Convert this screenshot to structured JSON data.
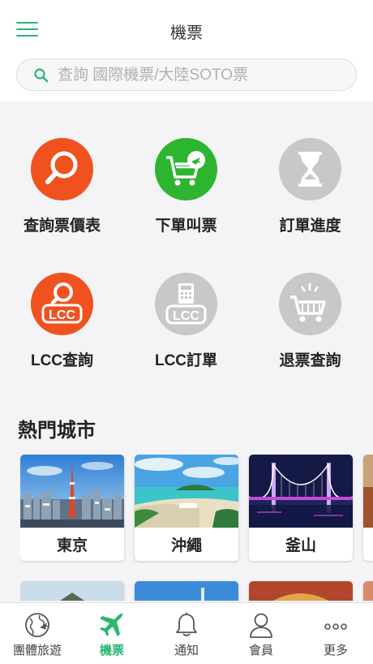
{
  "header": {
    "title": "機票",
    "search_placeholder": "查詢 國際機票/大陸SOTO票"
  },
  "menu": [
    {
      "label": "查詢票價表",
      "icon": "search-icon",
      "color": "#f0521f"
    },
    {
      "label": "下單叫票",
      "icon": "cart-plane-icon",
      "color": "#2db52f"
    },
    {
      "label": "訂單進度",
      "icon": "hourglass-icon",
      "color": "#c8c8c8"
    },
    {
      "label": "LCC查詢",
      "icon": "lcc-search-icon",
      "color": "#f0521f",
      "badge": "LCC"
    },
    {
      "label": "LCC訂單",
      "icon": "lcc-calculator-icon",
      "color": "#c8c8c8",
      "badge": "LCC"
    },
    {
      "label": "退票查詢",
      "icon": "cart-icon",
      "color": "#c8c8c8"
    }
  ],
  "popular": {
    "title": "熱門城市",
    "cities": [
      {
        "name": "東京"
      },
      {
        "name": "沖繩"
      },
      {
        "name": "釜山"
      }
    ]
  },
  "tabbar": [
    {
      "label": "團體旅遊",
      "icon": "globe-icon"
    },
    {
      "label": "機票",
      "icon": "airplane-icon",
      "active": true
    },
    {
      "label": "通知",
      "icon": "bell-icon"
    },
    {
      "label": "會員",
      "icon": "user-icon"
    },
    {
      "label": "更多",
      "icon": "more-icon"
    }
  ],
  "colors": {
    "accent": "#2bb673",
    "orange": "#f0521f",
    "green": "#2db52f",
    "grey": "#c8c8c8"
  }
}
